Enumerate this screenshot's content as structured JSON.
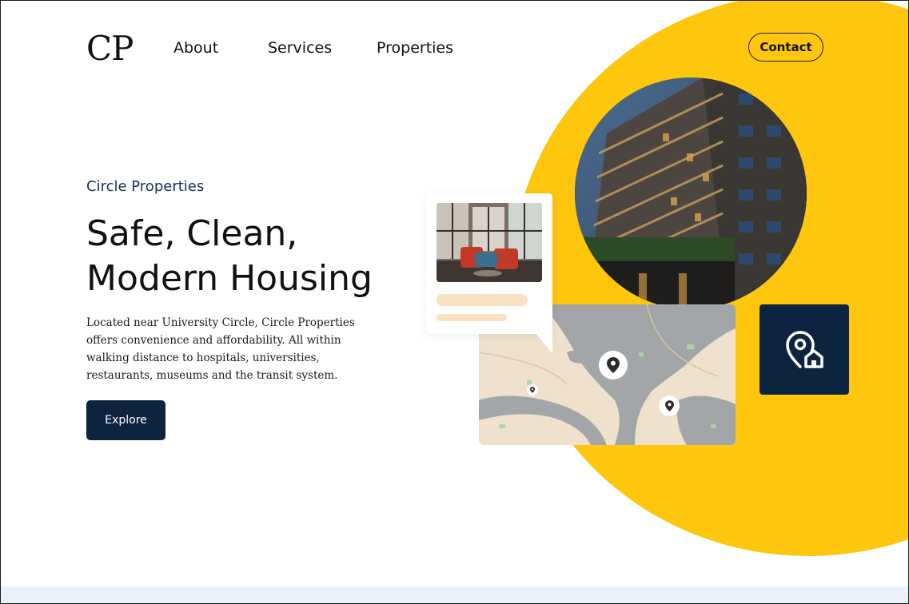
{
  "header": {
    "logo": "CP",
    "nav": [
      {
        "label": "About"
      },
      {
        "label": "Services"
      },
      {
        "label": "Properties"
      }
    ],
    "contact_label": "Contact"
  },
  "hero": {
    "eyebrow": "Circle Properties",
    "headline_line1": "Safe, Clean,",
    "headline_line2": "Modern Housing",
    "description": "Located near University Circle, Circle Properties offers convenience and affordability. All within walking distance to hospitals, universities, restaurants, museums and the transit system.",
    "cta_label": "Explore"
  },
  "colors": {
    "accent_yellow": "#ffc60e",
    "navy": "#0d2440",
    "eyebrow": "#13325b",
    "map_land": "#efe1cb",
    "map_water": "#a3a6a8",
    "skeleton": "#f8e2c1",
    "footer_band": "#eaf1fa"
  },
  "icons": {
    "map_pin": "location-pin-icon",
    "tile": "location-home-icon"
  }
}
